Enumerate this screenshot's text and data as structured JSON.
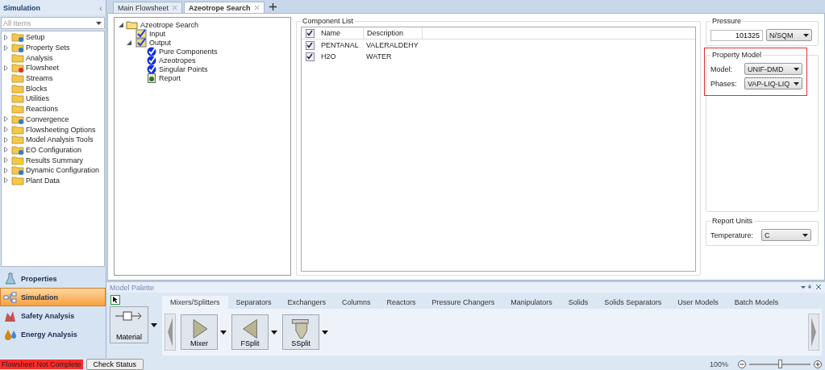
{
  "sidebar": {
    "title": "Simulation",
    "collapse": "‹",
    "filter": {
      "value": "All Items"
    },
    "items": [
      {
        "label": "Setup",
        "kind": "gear",
        "expandable": true
      },
      {
        "label": "Property Sets",
        "kind": "gear",
        "expandable": true
      },
      {
        "label": "Analysis",
        "kind": "plain",
        "expandable": false
      },
      {
        "label": "Flowsheet",
        "kind": "error",
        "expandable": true
      },
      {
        "label": "Streams",
        "kind": "plain",
        "expandable": false
      },
      {
        "label": "Blocks",
        "kind": "plain",
        "expandable": false
      },
      {
        "label": "Utilities",
        "kind": "plain",
        "expandable": false
      },
      {
        "label": "Reactions",
        "kind": "plain",
        "expandable": false
      },
      {
        "label": "Convergence",
        "kind": "gear",
        "expandable": true
      },
      {
        "label": "Flowsheeting Options",
        "kind": "plain",
        "expandable": true
      },
      {
        "label": "Model Analysis Tools",
        "kind": "plain",
        "expandable": true
      },
      {
        "label": "EO Configuration",
        "kind": "gear",
        "expandable": true
      },
      {
        "label": "Results Summary",
        "kind": "star",
        "expandable": true
      },
      {
        "label": "Dynamic Configuration",
        "kind": "gear",
        "expandable": true
      },
      {
        "label": "Plant Data",
        "kind": "plain",
        "expandable": true
      }
    ],
    "nav": [
      {
        "label": "Properties",
        "kind": "flask",
        "selected": false
      },
      {
        "label": "Simulation",
        "kind": "flow",
        "selected": true
      },
      {
        "label": "Safety Analysis",
        "kind": "safety",
        "selected": false
      },
      {
        "label": "Energy Analysis",
        "kind": "energy",
        "selected": false
      }
    ]
  },
  "tabs": [
    {
      "label": "Main Flowsheet",
      "selected": false
    },
    {
      "label": "Azeotrope Search",
      "selected": true
    }
  ],
  "tree": {
    "label": "Azeotrope Search",
    "children": [
      {
        "label": "Input",
        "kind": "form"
      },
      {
        "label": "Output",
        "kind": "folder",
        "children": [
          {
            "label": "Pure Components",
            "kind": "check"
          },
          {
            "label": "Azeotropes",
            "kind": "check"
          },
          {
            "label": "Singular Points",
            "kind": "check"
          },
          {
            "label": "Report",
            "kind": "report"
          }
        ]
      }
    ]
  },
  "component_list": {
    "title": "Component List",
    "header_checked": true,
    "columns": [
      "Name",
      "Description"
    ],
    "rows": [
      {
        "checked": true,
        "cells": [
          "PENTANAL",
          "VALERALDEHY"
        ]
      },
      {
        "checked": true,
        "cells": [
          "H2O",
          "WATER"
        ]
      }
    ]
  },
  "pressure": {
    "title": "Pressure",
    "value": "101325",
    "unit": "N/SQM"
  },
  "property_model": {
    "title": "Property Model",
    "fields": [
      {
        "label": "Model:",
        "value": "UNIF-DMD",
        "focused": false
      },
      {
        "label": "Phases:",
        "value": "VAP-LIQ-LIQ",
        "focused": true
      }
    ]
  },
  "report_units": {
    "title": "Report Units",
    "label": "Temperature:",
    "value": "C"
  },
  "palette": {
    "title": "Model Palette",
    "tabs": [
      {
        "label": "Mixers/Splitters",
        "selected": true
      },
      {
        "label": "Separators",
        "selected": false
      },
      {
        "label": "Exchangers",
        "selected": false
      },
      {
        "label": "Columns",
        "selected": false
      },
      {
        "label": "Reactors",
        "selected": false
      },
      {
        "label": "Pressure Changers",
        "selected": false
      },
      {
        "label": "Manipulators",
        "selected": false
      },
      {
        "label": "Solids",
        "selected": false
      },
      {
        "label": "Solids Separators",
        "selected": false
      },
      {
        "label": "User Models",
        "selected": false
      },
      {
        "label": "Batch Models",
        "selected": false
      }
    ],
    "material": "Material",
    "models": [
      {
        "label": "Mixer",
        "kind": "mixer"
      },
      {
        "label": "FSplit",
        "kind": "fsplit"
      },
      {
        "label": "SSplit",
        "kind": "ssplit"
      }
    ]
  },
  "status_bar": {
    "status": "Flowsheet Not Complete",
    "button": "Check Status",
    "zoom": "100%",
    "level": 0.5
  }
}
